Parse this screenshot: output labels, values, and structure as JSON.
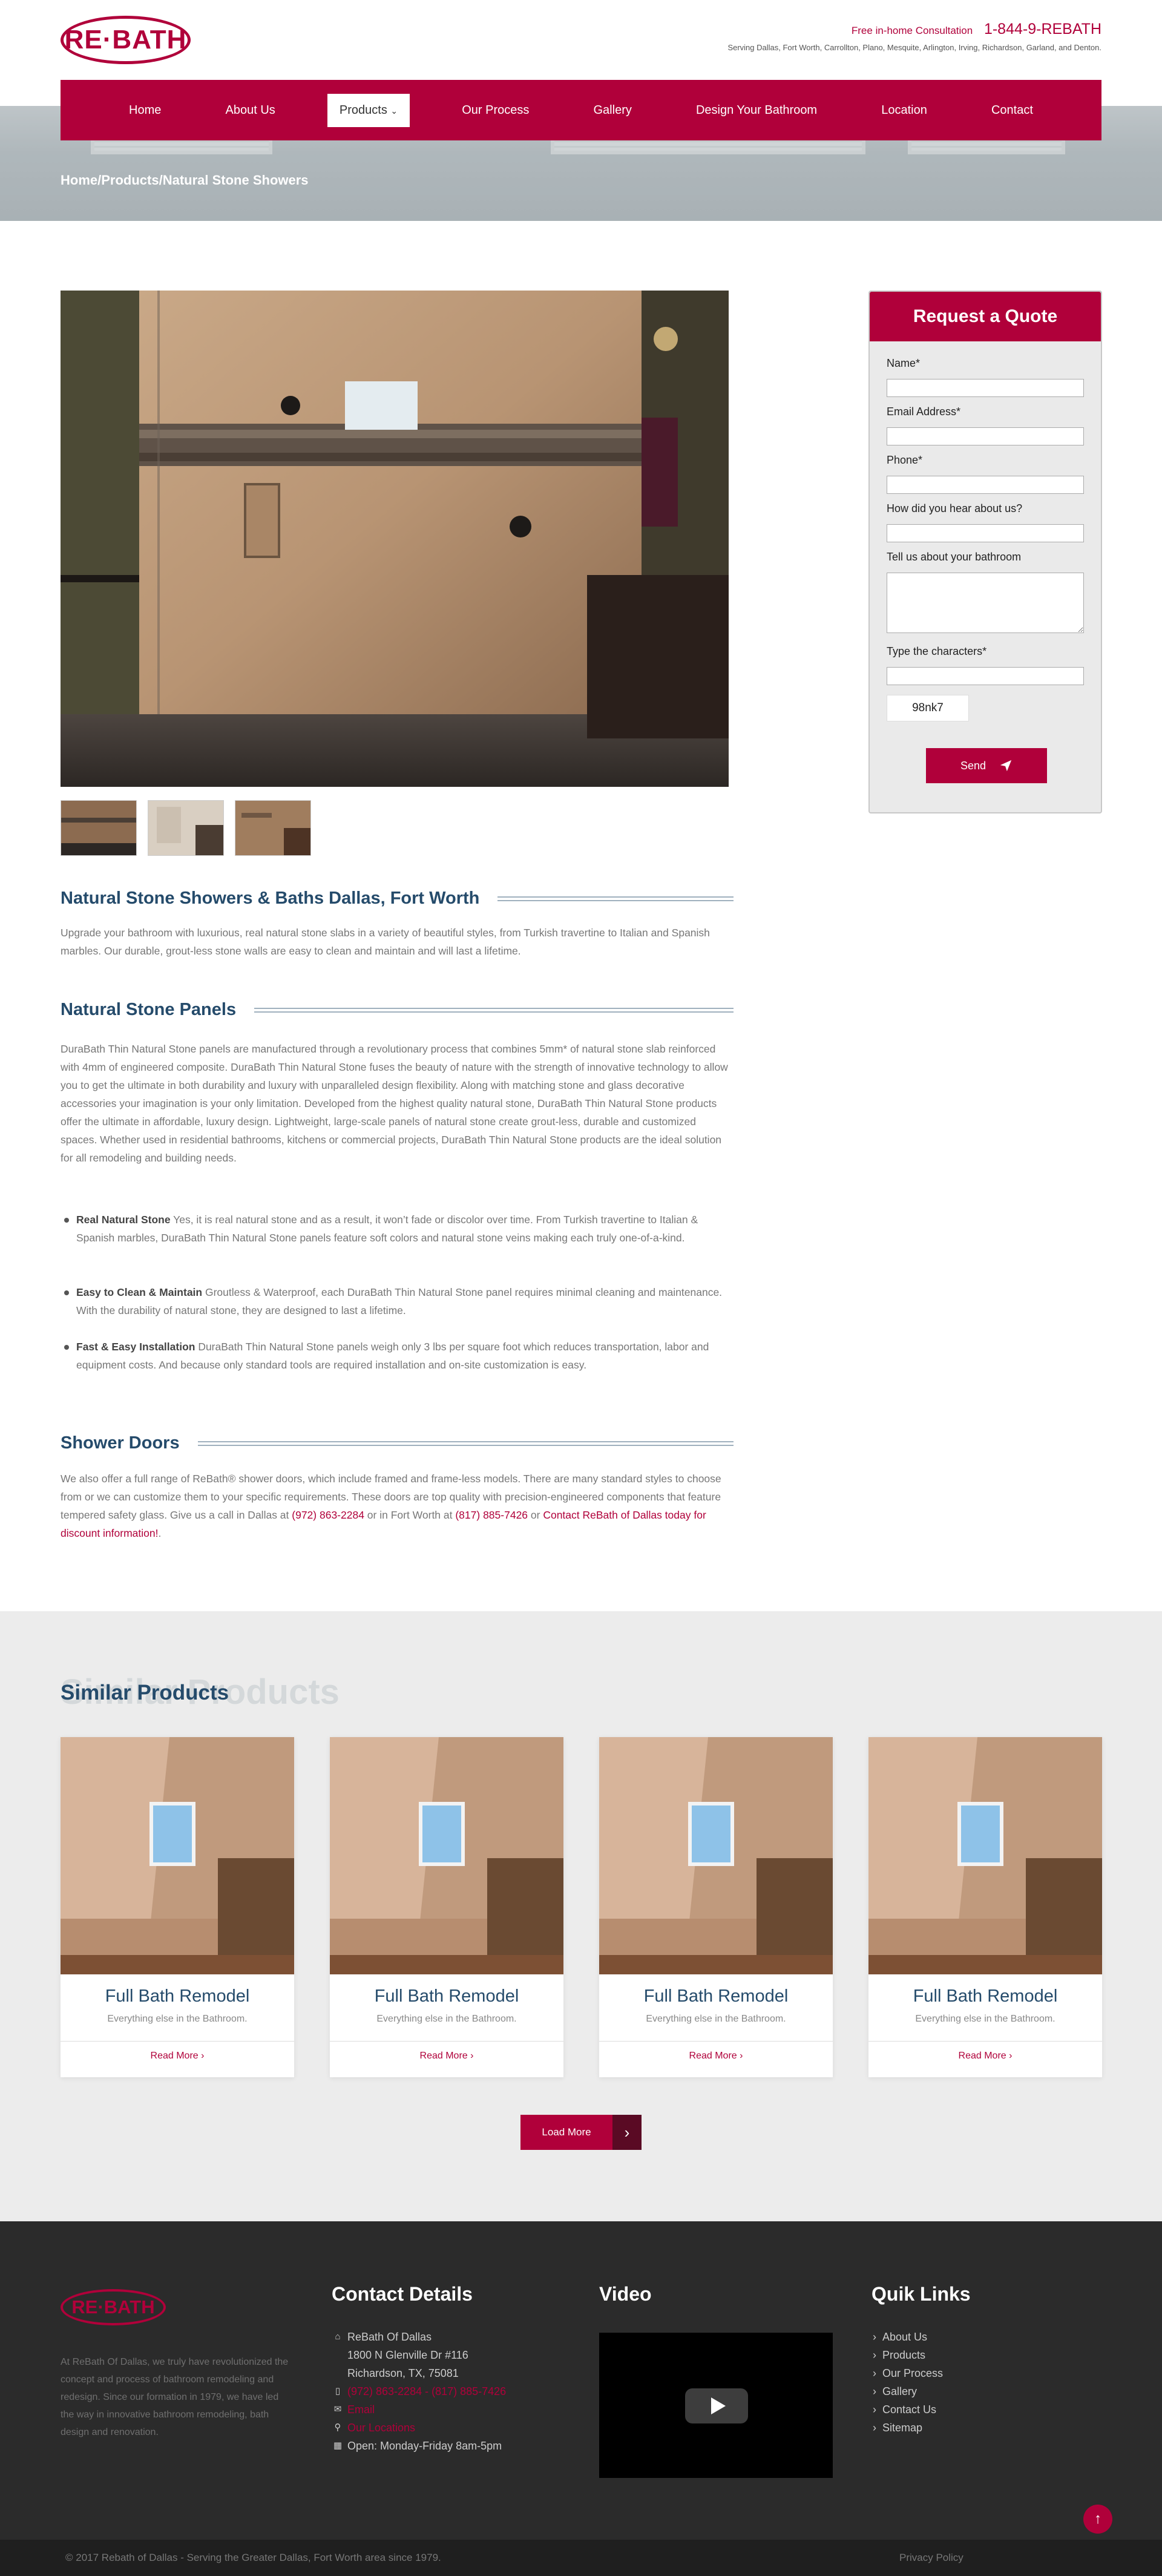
{
  "header": {
    "logo_text": "RE·BATH",
    "consult_label": "Free in-home Consultation",
    "phone": "1-844-9-REBATH",
    "serving": "Serving Dallas, Fort Worth, Carrollton, Plano, Mesquite, Arlington, Irving, Richardson, Garland, and Denton."
  },
  "nav": {
    "items": [
      "Home",
      "About Us",
      "Products",
      "Our Process",
      "Gallery",
      "Design Your Bathroom",
      "Location",
      "Contact"
    ],
    "active": "Products"
  },
  "breadcrumb": "Home/Products/Natural Stone Showers",
  "content": {
    "h1": "Natural Stone Showers & Baths Dallas, Fort Worth",
    "intro": "Upgrade your bathroom with luxurious, real natural stone slabs in a variety of beautiful styles, from Turkish travertine to Italian and Spanish marbles. Our durable, grout-less stone walls are easy to clean and maintain and will last a lifetime.",
    "h2": "Natural Stone Panels",
    "panels_text": "DuraBath Thin Natural Stone panels are manufactured through a revolutionary process that combines 5mm* of natural stone slab reinforced with 4mm of engineered composite. DuraBath Thin Natural Stone fuses the beauty of nature with the strength  of innovative technology to allow you to get the ultimate in both durability and luxury with unparalleled design  flexibility. Along with matching stone and glass decorative accessories your imagination is your only limitation. Developed from the highest quality natural stone, DuraBath Thin Natural Stone products offer the ultimate in affordable, luxury design. Lightweight, large-scale panels of natural stone create grout-less, durable and customized  spaces. Whether used in residential bathrooms, kitchens or commercial projects, DuraBath Thin Natural Stone products are the ideal solution for all remodeling and building needs.",
    "bullets": [
      {
        "title": "Real Natural Stone",
        "text": " Yes, it is real natural stone and as a result, it won’t  fade or discolor over time. From Turkish travertine to  Italian & Spanish marbles, DuraBath Thin Natural Stone panels feature soft colors and natural stone veins making each truly one-of-a-kind."
      },
      {
        "title": "Easy to Clean & Maintain",
        "text": " Groutless & Waterproof, each DuraBath Thin Natural Stone panel requires minimal cleaning and maintenance. With the  durability of natural stone, they are designed to last a lifetime."
      },
      {
        "title": "Fast & Easy Installation",
        "text": " DuraBath Thin Natural Stone panels weigh only 3 lbs per square foot  which reduces transportation, labor and equipment  costs. And because only standard tools are required installation and on-site customization is easy."
      }
    ],
    "h3": "Shower Doors",
    "doors_text_1": "We also offer a full range of ReBath® shower doors, which include framed and frame-less models. There are many standard styles to choose from or we can customize them to your specific requirements. These doors are top quality with precision-engineered components that feature tempered safety glass. Give us a call in Dallas at ",
    "doors_phone_dallas": "(972) 863-2284",
    "doors_text_2": " or in Fort Worth at ",
    "doors_phone_fw": "(817) 885-7426",
    "doors_text_3": " or ",
    "doors_link": "Contact ReBath of Dallas today for discount information!",
    "doors_text_4": "."
  },
  "quote": {
    "title": "Request a Quote",
    "labels": [
      "Name*",
      "Email Address*",
      "Phone*",
      "How did you hear about us?",
      "Tell us about your bathroom",
      "Type the characters*"
    ],
    "captcha": "98nk7",
    "send": "Send"
  },
  "similar": {
    "ghost": "Similar Products",
    "title": "Similar Products",
    "cards": [
      {
        "title": "Full Bath Remodel",
        "sub": "Everything else in the Bathroom.",
        "more": "Read More"
      },
      {
        "title": "Full Bath Remodel",
        "sub": "Everything else in the Bathroom.",
        "more": "Read More"
      },
      {
        "title": "Full Bath Remodel",
        "sub": "Everything else in the Bathroom.",
        "more": "Read More"
      },
      {
        "title": "Full Bath Remodel",
        "sub": "Everything else in the Bathroom.",
        "more": "Read More"
      }
    ],
    "load_more": "Load More"
  },
  "footer": {
    "logo_text": "RE·BATH",
    "about": "At ReBath Of Dallas, we truly have revolutionized the concept and process of bathroom remodeling and redesign. Since our formation in 1979, we have led the way in innovative bathroom remodeling, bath design and renovation.",
    "contact_head": "Contact Details",
    "company": "ReBath Of Dallas",
    "addr1": "1800 N Glenville Dr #116",
    "addr2": "Richardson, TX, 75081",
    "phones": "(972) 863-2284 - (817) 885-7426",
    "email": "Email",
    "locations": "Our Locations",
    "hours": "Open: Monday-Friday 8am-5pm",
    "video_head": "Video",
    "quick_head": "Quik Links",
    "quick_links": [
      "About Us",
      "Products",
      "Our Process",
      "Gallery",
      "Contact Us",
      "Sitemap"
    ],
    "copyright": "© 2017 Rebath of Dallas - Serving the Greater Dallas, Fort Worth area since 1979.",
    "privacy": "Privacy Policy"
  },
  "icons": {
    "chevron": "chevron-down-icon",
    "home": "home-icon",
    "phone": "mobile-phone-icon",
    "email": "envelope-icon",
    "location": "map-marker-icon",
    "calendar": "calendar-icon",
    "send": "paper-plane-icon",
    "arrow": "chevron-right-icon",
    "up": "arrow-up-icon"
  },
  "colors": {
    "brand": "#b0003a",
    "heading": "#254b6b"
  }
}
